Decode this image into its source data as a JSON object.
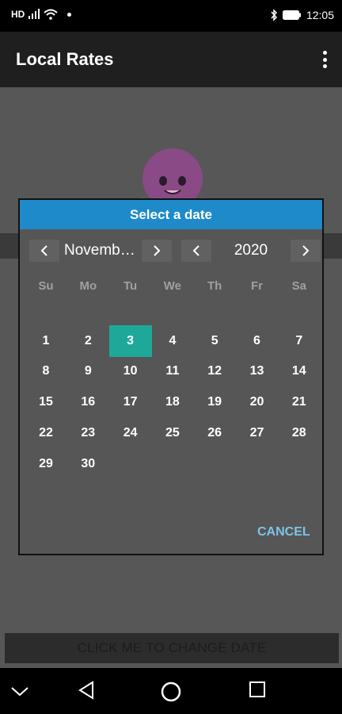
{
  "status_bar": {
    "left_label": "HD",
    "time": "12:05"
  },
  "app_bar": {
    "title": "Local Rates"
  },
  "dialog": {
    "title": "Select a date",
    "month_label": "Novemb…",
    "year_label": "2020",
    "weekdays": [
      "Su",
      "Mo",
      "Tu",
      "We",
      "Th",
      "Fr",
      "Sa"
    ],
    "days": [
      "1",
      "2",
      "3",
      "4",
      "5",
      "6",
      "7",
      "8",
      "9",
      "10",
      "11",
      "12",
      "13",
      "14",
      "15",
      "16",
      "17",
      "18",
      "19",
      "20",
      "21",
      "22",
      "23",
      "24",
      "25",
      "26",
      "27",
      "28",
      "29",
      "30"
    ],
    "selected_day": "3",
    "selected_color": "#1ea89a",
    "cancel_label": "CANCEL"
  },
  "background": {
    "change_date_label": "CLICK ME TO CHANGE DATE"
  }
}
